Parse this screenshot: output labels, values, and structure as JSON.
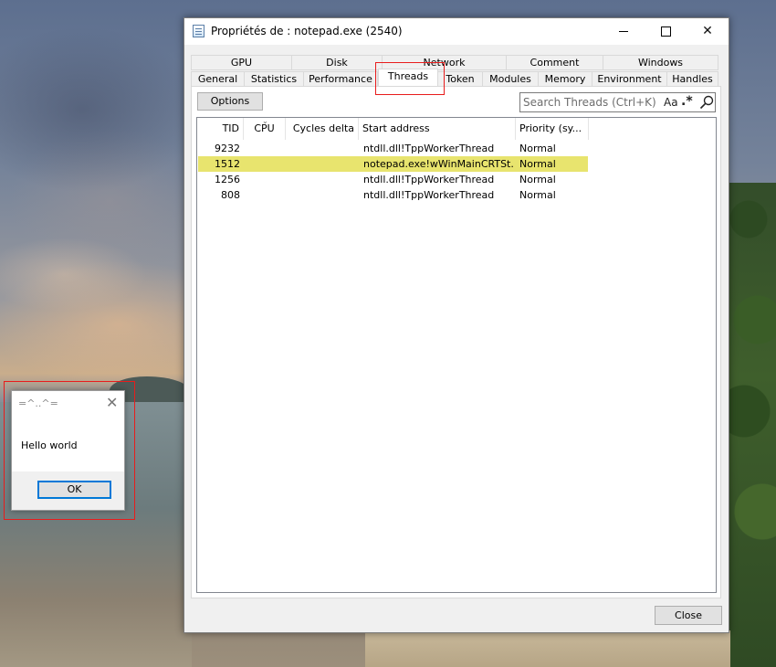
{
  "window": {
    "title": "Propriétés de : notepad.exe (2540)",
    "close_button": "Close"
  },
  "tabs": {
    "row1": [
      "GPU",
      "Disk",
      "Network",
      "Comment",
      "Windows"
    ],
    "row2": [
      "General",
      "Statistics",
      "Performance",
      "Threads",
      "Token",
      "Modules",
      "Memory",
      "Environment",
      "Handles"
    ],
    "active": "Threads"
  },
  "toolbar": {
    "options_label": "Options",
    "search_placeholder": "Search Threads (Ctrl+K)",
    "case_toggle": "Aa",
    "regex_toggle": ".*"
  },
  "threads": {
    "columns": [
      "TID",
      "CPU",
      "Cycles delta",
      "Start address",
      "Priority (sy..."
    ],
    "sorted_column": "CPU",
    "rows": [
      {
        "tid": "9232",
        "cpu": "",
        "cycles": "",
        "start": "ntdll.dll!TppWorkerThread",
        "priority": "Normal",
        "highlight": false
      },
      {
        "tid": "1512",
        "cpu": "",
        "cycles": "",
        "start": "notepad.exe!wWinMainCRTSt...",
        "priority": "Normal",
        "highlight": true
      },
      {
        "tid": "1256",
        "cpu": "",
        "cycles": "",
        "start": "ntdll.dll!TppWorkerThread",
        "priority": "Normal",
        "highlight": false
      },
      {
        "tid": "808",
        "cpu": "",
        "cycles": "",
        "start": "ntdll.dll!TppWorkerThread",
        "priority": "Normal",
        "highlight": false
      }
    ],
    "highlight_color": "#e8e46e"
  },
  "message_box": {
    "title": "=^..^=",
    "text": "Hello world",
    "ok_label": "OK"
  },
  "colors": {
    "annotation_red": "#e81c1c",
    "focus_blue": "#0078d7"
  }
}
